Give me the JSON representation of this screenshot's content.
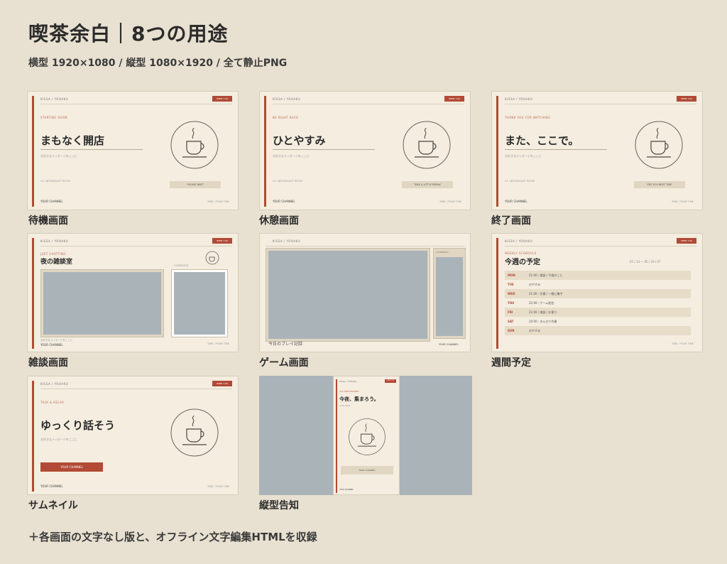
{
  "header": {
    "title": "喫茶余白｜8つの用途",
    "subtitle": "横型 1920×1080 / 縦型 1080×1920 / 全て静止PNG"
  },
  "common": {
    "brand": "KISSA / YOHAKU",
    "tag": "OPEN 7:00",
    "message": "お好きなメッセージをここに",
    "meta": "01 / BROADCAST ROOM",
    "channel": "YOUR CHANNEL",
    "time_label": "TIME / YOUR TIME"
  },
  "cards": [
    {
      "label": "待機画面",
      "kicker": "STARTING SOON",
      "title": "まもなく開店",
      "button": "PLEASE WAIT"
    },
    {
      "label": "休憩画面",
      "kicker": "BE RIGHT BACK",
      "title": "ひとやすみ",
      "button": "TAKE A LITTLE BREAK"
    },
    {
      "label": "終了画面",
      "kicker": "THANK YOU FOR WATCHING",
      "title": "また、ここで。",
      "button": "SEE YOU NEXT TIME"
    },
    {
      "label": "雑談画面",
      "kicker": "JUST CHATTING",
      "title": "夜の雑談室",
      "comments": "COMMENTS"
    },
    {
      "label": "ゲーム画面",
      "game_caption": "今日のプレイ記録",
      "comments": "COMMENTS"
    },
    {
      "label": "週間予定",
      "kicker": "WEEKLY SCHEDULE",
      "title": "今週の予定",
      "range": "05 / 14 — 05 / 20 / 07",
      "schedule": [
        {
          "day": "MON",
          "text": "21:00｜雑談 / 今週のこと"
        },
        {
          "day": "TUE",
          "text": "おやすみ"
        },
        {
          "day": "WED",
          "text": "21:00｜作業 / 一緒に集中"
        },
        {
          "day": "THU",
          "text": "22:00｜ゲーム配信"
        },
        {
          "day": "FRI",
          "text": "21:00｜雑談 / お便り"
        },
        {
          "day": "SAT",
          "text": "20:00｜のんびり作業"
        },
        {
          "day": "SUN",
          "text": "おやすみ"
        }
      ]
    },
    {
      "label": "サムネイル",
      "kicker": "TALK & RELAX",
      "title": "ゆっくり話そう",
      "button": "YOUR CHANNEL"
    },
    {
      "label": "縦型告知",
      "kicker": "LIVE ANNOUNCEMENT",
      "title": "今夜、集まろう。",
      "sub": "21:00 START",
      "button": "YOUR CHANNEL"
    }
  ],
  "footer": "＋各画面の文字なし版と、オフライン文字編集HTMLを収録",
  "colors": {
    "accent": "#b24a35",
    "paper": "#f4ede0",
    "bg": "#e8e0d0",
    "placeholder": "#a9b3b8"
  }
}
